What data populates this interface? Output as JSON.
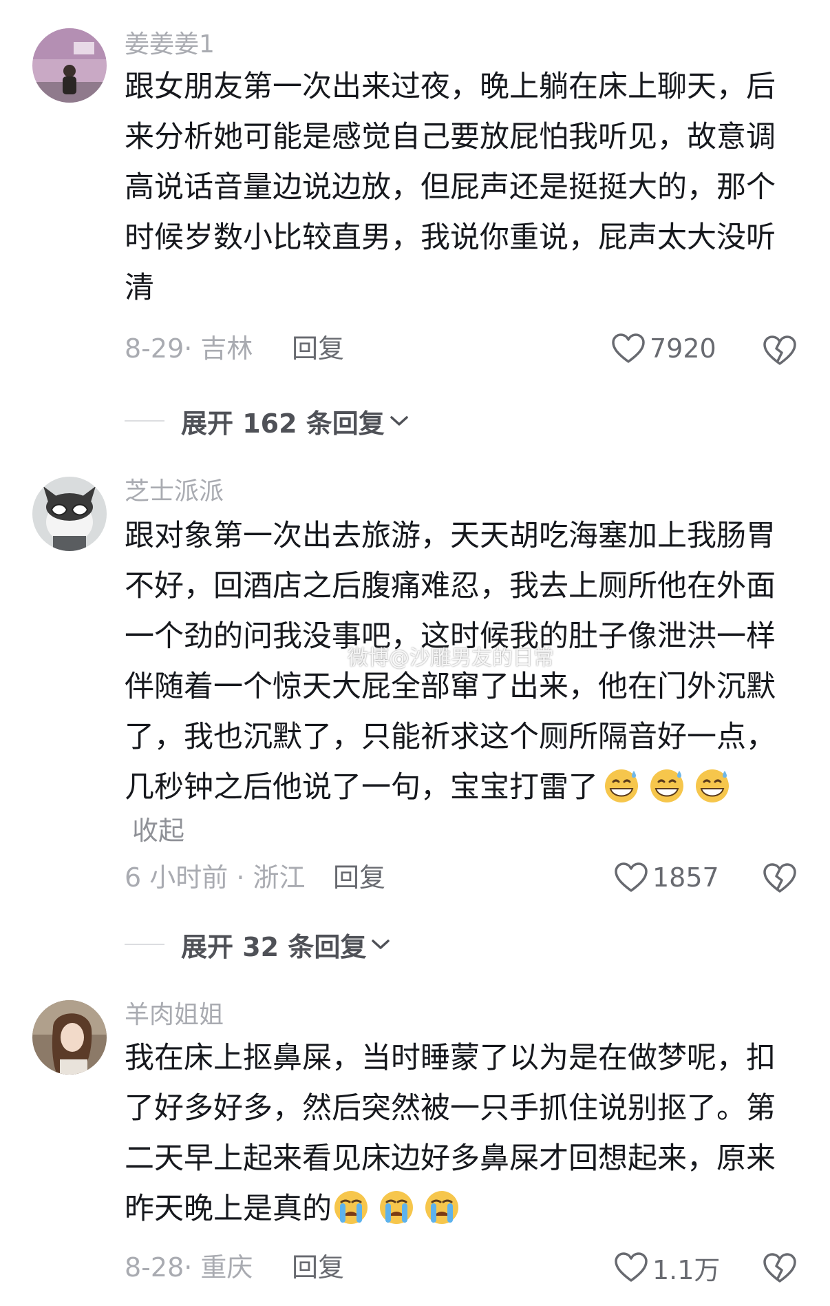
{
  "comments": [
    {
      "username": "姜姜姜1",
      "lines": [
        "跟女朋友第一次出来过夜，晚上躺在床上聊天，后",
        "来分析她可能是感觉自己要放屁怕我听见，故意调",
        "高说话音量边说边放，但屁声还是挺挺大的，那个",
        "时候岁数小比较直男，我说你重说，屁声太大没听",
        "清"
      ],
      "meta": "8-29· 吉林",
      "reply_label": "回复",
      "likes": "7920",
      "expand": "展开 162 条回复"
    },
    {
      "username": "芝士派派",
      "lines": [
        "跟对象第一次出去旅游，天天胡吃海塞加上我肠胃",
        "不好，回酒店之后腹痛难忍，我去上厕所他在外面",
        "一个劲的问我没事吧，这时候我的肚子像泄洪一样",
        "伴随着一个惊天大屁全部窜了出来，他在门外沉默",
        "了，我也沉默了，只能祈求这个厕所隔音好一点，",
        "几秒钟之后他说了一句，宝宝打雷了"
      ],
      "emoji": "grin-sweat-emoji",
      "collapse_label": "收起",
      "meta": "6 小时前 · 浙江",
      "reply_label": "回复",
      "likes": "1857",
      "expand": "展开 32 条回复"
    },
    {
      "username": "羊肉姐姐",
      "lines": [
        "我在床上抠鼻屎，当时睡蒙了以为是在做梦呢，扣",
        "了好多好多，然后突然被一只手抓住说别抠了。第",
        "二天早上起来看见床边好多鼻屎才回想起来，原来",
        "昨天晚上是真的"
      ],
      "emoji": "crying-emoji",
      "meta": "8-28· 重庆",
      "reply_label": "回复",
      "likes": "1.1万"
    }
  ],
  "watermark": "微博@沙雕男友的日常",
  "colors": {
    "text": "#16181d",
    "muted": "#a9abb1",
    "action": "#686a70"
  }
}
